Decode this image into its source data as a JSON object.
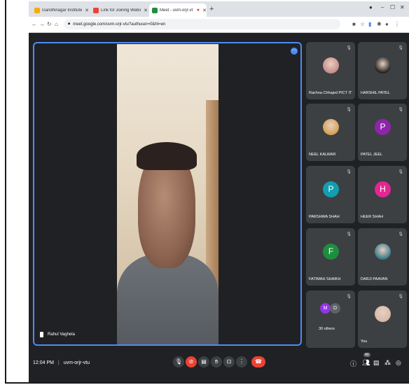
{
  "browser": {
    "tabs": [
      {
        "label": "Gandhinagar Institute of Technol...",
        "color": "#f9ab00"
      },
      {
        "label": "Link for Joining Webinar (3rd Jul...",
        "color": "#ea4335"
      },
      {
        "label": "Meet - uvm-orjr-vtu",
        "color": "#1e8e3e"
      }
    ],
    "new_tab": "+",
    "window_controls": [
      "–",
      "☐",
      "✕"
    ],
    "url": "meet.google.com/uvm-orjr-vtu?authuser=0&hl=en"
  },
  "meeting": {
    "presenter_name": "Rahul Vaghela",
    "time": "12:04 PM",
    "separator": "|",
    "code": "uvm-orjr-vtu",
    "participant_count": "40"
  },
  "participants": [
    {
      "name": "Rachna Chhajed PICT IT",
      "type": "photo",
      "color": "#c88c8c"
    },
    {
      "name": "HARSHIL PATEL",
      "type": "photo",
      "color": "#222222"
    },
    {
      "name": "NEEL KALWAR",
      "type": "photo",
      "color": "#d4a055"
    },
    {
      "name": "PATEL JEEL",
      "type": "letter",
      "letter": "P",
      "color": "#8e24aa"
    },
    {
      "name": "PARSHWA SHAH",
      "type": "letter",
      "letter": "P",
      "color": "#129eaf"
    },
    {
      "name": "HEER SHAH",
      "type": "letter",
      "letter": "H",
      "color": "#e52592"
    },
    {
      "name": "FATIMAH SHAIKH",
      "type": "letter",
      "letter": "F",
      "color": "#1e8e3e"
    },
    {
      "name": "DARJI PAAVAN",
      "type": "photo",
      "color": "#3b7a8a"
    },
    {
      "name": "30 others",
      "type": "group",
      "letters": [
        "M",
        "D"
      ],
      "colors": [
        "#9334e6",
        "#5f6368"
      ]
    },
    {
      "name": "You",
      "type": "photo",
      "color": "#d6b8a8"
    }
  ]
}
